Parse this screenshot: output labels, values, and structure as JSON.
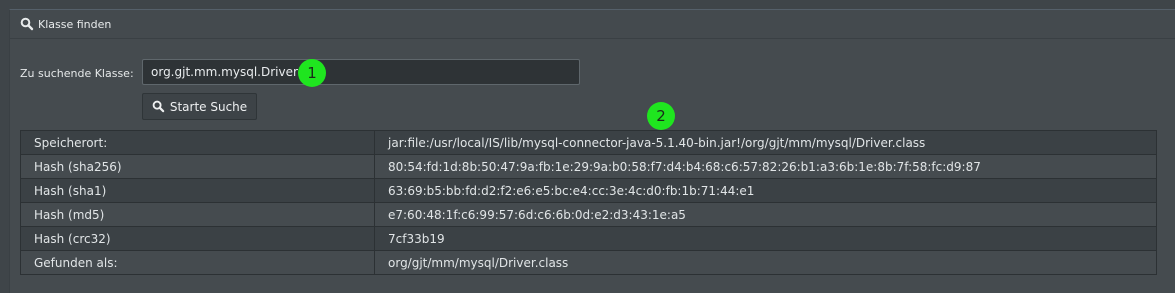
{
  "panel": {
    "title": "Klasse finden",
    "title_icon": "search-icon"
  },
  "search": {
    "label": "Zu suchende Klasse:",
    "value": "org.gjt.mm.mysql.Driver",
    "button_label": "Starte Suche",
    "button_icon": "search-icon"
  },
  "annotations": {
    "badge1": "1",
    "badge2": "2",
    "color": "#1fe51f"
  },
  "results": [
    {
      "key": "Speicherort:",
      "value": "jar:file:/usr/local/IS/lib/mysql-connector-java-5.1.40-bin.jar!/org/gjt/mm/mysql/Driver.class"
    },
    {
      "key": "Hash (sha256)",
      "value": "80:54:fd:1d:8b:50:47:9a:fb:1e:29:9a:b0:58:f7:d4:b4:68:c6:57:82:26:b1:a3:6b:1e:8b:7f:58:fc:d9:87"
    },
    {
      "key": "Hash (sha1)",
      "value": "63:69:b5:bb:fd:d2:f2:e6:e5:bc:e4:cc:3e:4c:d0:fb:1b:71:44:e1"
    },
    {
      "key": "Hash (md5)",
      "value": "e7:60:48:1f:c6:99:57:6d:c6:6b:0d:e2:d3:43:1e:a5"
    },
    {
      "key": "Hash (crc32)",
      "value": "7cf33b19"
    },
    {
      "key": "Gefunden als:",
      "value": "org/gjt/mm/mysql/Driver.class"
    }
  ]
}
